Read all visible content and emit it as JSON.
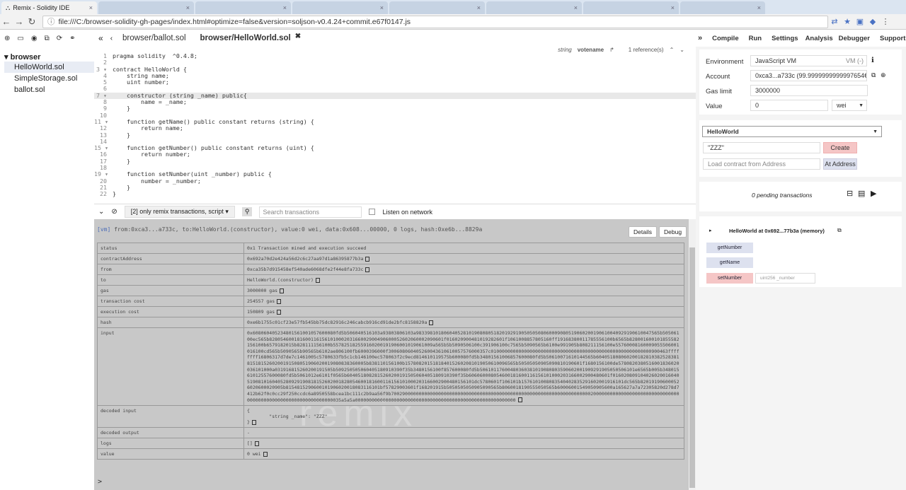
{
  "browser": {
    "tabs": [
      {
        "label": "Remix - Solidity IDE",
        "active": true
      },
      {
        "label": "",
        "active": false
      },
      {
        "label": "",
        "active": false
      },
      {
        "label": "",
        "active": false
      },
      {
        "label": "",
        "active": false
      },
      {
        "label": "",
        "active": false
      },
      {
        "label": "",
        "active": false
      },
      {
        "label": "",
        "active": false
      }
    ],
    "url": "file:///C:/browser-solidity-gh-pages/index.html#optimize=false&version=soljson-v0.4.24+commit.e67f0147.js"
  },
  "files": {
    "folder": "browser",
    "items": [
      "HelloWorld.sol",
      "SimpleStorage.sol",
      "ballot.sol"
    ],
    "selected_index": 0
  },
  "editor": {
    "tabs": [
      "browser/ballot.sol",
      "browser/HelloWorld.sol"
    ],
    "active_tab": 1,
    "ref_type": "string",
    "ref_name": "votename",
    "ref_count": "1 reference(s)",
    "lines": [
      "pragma solidity  ^0.4.8;",
      "",
      "contract HelloWorld {",
      "    string name;",
      "    uint number;",
      "",
      "    constructor (string _name) public{",
      "        name = _name;",
      "    }",
      "",
      "    function getName() public constant returns (string) {",
      "        return name;",
      "    }",
      "",
      "    function getNumber() public constant returns (uint) {",
      "        return number;",
      "    }",
      "",
      "    function setNumber(uint _number) public {",
      "        number = _number;",
      "    }",
      "}"
    ]
  },
  "terminal": {
    "filter": "[2] only remix transactions, script",
    "search_placeholder": "Search transactions",
    "listen_label": "Listen on network",
    "summary_tag": "[vm]",
    "summary": " from:0xca3...a733c, to:HelloWorld.(constructor), value:0 wei, data:0x608...00000, 0 logs, hash:0xe6b...8829a",
    "details_label": "Details",
    "debug_label": "Debug",
    "watermark": "remix",
    "prompt": ">",
    "rows": [
      {
        "key": "status",
        "value": "0x1 Transaction mined and execution succeed"
      },
      {
        "key": "contractAddress",
        "value": "0x692a70d2e424a56d2c6c27aa97d1a86395877b3a"
      },
      {
        "key": "from",
        "value": "0xca35b7d915458ef540ade6068dfe2f44e8fa733c"
      },
      {
        "key": "to",
        "value": "HelloWorld.(constructor)"
      },
      {
        "key": "gas",
        "value": "3000000 gas"
      },
      {
        "key": "transaction cost",
        "value": "254557 gas"
      },
      {
        "key": "execution cost",
        "value": "150809 gas"
      },
      {
        "key": "hash",
        "value": "0xe6b1755c01cf23e57fb545bb75dc82916c246cabcb916cd91de2bfc8158829a"
      },
      {
        "key": "input",
        "value": "0x608060405234801561001057600080fd5b506040516103a93803806103a9833981018060405281019080805182019291905050508060009080519060200190610040929190610047565b50506100ec565b828054600181600116156101000203166002900490600052602060002090601f016020900481019282601f1061008857805160ff19168380011785556100b6565b828001600101855582156100b6579182015b828111156100b557825182559160200191906001019061009a565b5b5090506100c391906100c7565b5090565b6100e991905b808211156100e55760008160009055506001016100cd565b5090565b90565b6102ae806100fb6000396000f300608060405260043610610057576000357c0100000000000000000000000000000000000000000000000000000000900463ffffffff16806317d7de7c1461005c5780633fb5c1cb146100ec578063f2c9ecd814610119575b600080fd5b34801561006857600080fd5b50610071610144565b6040518080602001828103825283818151815260200191508051906020019080838360005b838110156100b1578082015181840152602081019050610096565b50505050905090810190601f1680156100de5780820380516001836020036101000a031916815260200191505b509250505060405180910390f35b3480156100f857600080fd5b50610117600480360381019080803590602001909291905050506101e6565b005b34801561012557600080fd5b5061012e6101f0565b6040518082815260200191505060405180910390f35b606060008054600181600116156101000203166002900480601f0160208091040260200160405190810160405280929190818152602001828054600181600116156101000203166002900480156101dc5780601f106101b1576101008083540402835291602001916101dc565b820191906000526020600020905b8154815290600101906020018083116101bf57829003601f168201915b5050505050905090565b8060018190555050565b60006001549050905600a165627a7a72305820d278d7412b62f0c0cc29f250ccdc6a8950558bcea1bc111c2b9aa56f9b700290000000000000000000000000000000000000000000000000000000000000000000200000000000000000000000000000000000000000000000000000000000000035a5a5a0000000000000000000000000000000000000000000000000000000000"
      },
      {
        "key": "decoded input",
        "value": "{\n        \"string _name\": \"ZZZ\"\n}"
      },
      {
        "key": "decoded output",
        "value": " -"
      },
      {
        "key": "logs",
        "value": "[]"
      },
      {
        "key": "value",
        "value": "0 wei"
      }
    ]
  },
  "right": {
    "tabs": [
      "Compile",
      "Run",
      "Settings",
      "Analysis",
      "Debugger",
      "Support"
    ],
    "environment_label": "Environment",
    "environment_value": "JavaScript VM",
    "vm_badge": "VM (-)",
    "account_label": "Account",
    "account_value": "0xca3...a733c (99.9999999999997654€",
    "gaslimit_label": "Gas limit",
    "gaslimit_value": "3000000",
    "value_label": "Value",
    "value_value": "0",
    "value_unit": "wei",
    "contract_select": "HelloWorld",
    "create_input": "\"ZZZ\"",
    "create_button": "Create",
    "at_address_placeholder": "Load contract from Address",
    "at_address_button": "At Address",
    "pending": "0 pending transactions",
    "instance_title": "HelloWorld at 0x692...77b3a (memory)",
    "functions": [
      {
        "label": "getNumber",
        "kind": "call"
      },
      {
        "label": "getName",
        "kind": "call"
      },
      {
        "label": "setNumber",
        "kind": "transact",
        "param_placeholder": "uint256 _number"
      }
    ]
  }
}
